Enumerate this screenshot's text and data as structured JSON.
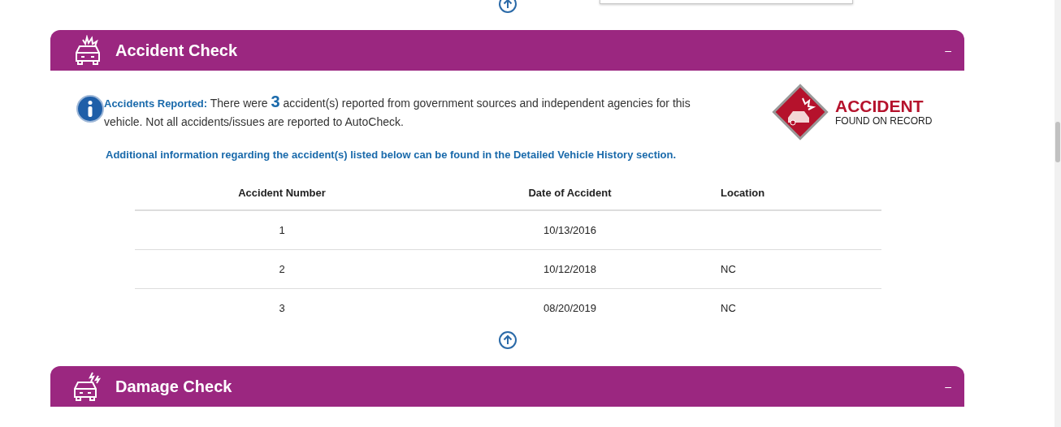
{
  "sections": [
    {
      "kind": "accident",
      "title": "Accident Check",
      "toggle": "–",
      "notice": {
        "label": "Accidents Reported:",
        "before": "There were",
        "count": "3",
        "after": "accident(s) reported from government sources and independent agencies for this vehicle. Not all accidents/issues are reported to AutoCheck."
      },
      "badge": {
        "title": "ACCIDENT",
        "subtitle": "FOUND ON RECORD"
      },
      "note": "Additional information regarding the accident(s) listed below can be found in the Detailed Vehicle History section.",
      "table": {
        "columns": [
          "Accident Number",
          "Date of Accident",
          "Location"
        ],
        "rows": [
          [
            "1",
            "10/13/2016",
            ""
          ],
          [
            "2",
            "10/12/2018",
            "NC"
          ],
          [
            "3",
            "08/20/2019",
            "NC"
          ]
        ]
      }
    },
    {
      "kind": "damage",
      "title": "Damage Check",
      "toggle": "–"
    }
  ]
}
